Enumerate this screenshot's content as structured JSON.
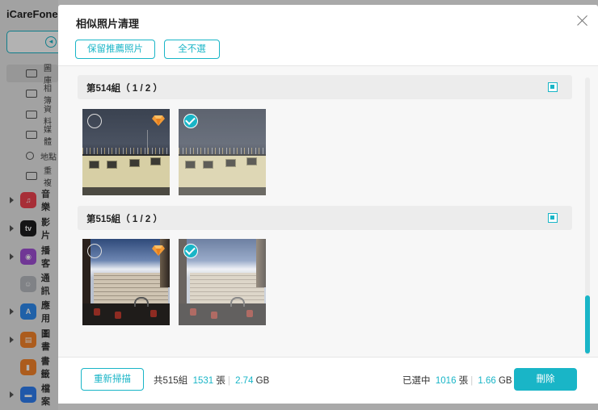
{
  "app": {
    "name": "iCareFone",
    "nav": [
      "圖庫",
      "相簿",
      "資料",
      "媒體",
      "地點",
      "重複"
    ],
    "apps": [
      {
        "label": "音樂",
        "color": "#f0424f",
        "glyph": "♫"
      },
      {
        "label": "影片",
        "color": "#1d1d1f",
        "glyph": "tv"
      },
      {
        "label": "播客",
        "color": "#a14fd6",
        "glyph": "◉"
      },
      {
        "label": "通訊",
        "color": "#b8bbc1",
        "glyph": "☺"
      },
      {
        "label": "應用",
        "color": "#2f8cf1",
        "glyph": "A"
      },
      {
        "label": "圖書",
        "color": "#f6852a",
        "glyph": "▤"
      },
      {
        "label": "書籤",
        "color": "#f6852a",
        "glyph": "▮"
      },
      {
        "label": "檔案",
        "color": "#2f7ef2",
        "glyph": "▬"
      }
    ]
  },
  "modal": {
    "title": "相似照片清理",
    "keep_recommended_label": "保留推薦照片",
    "deselect_all_label": "全不選"
  },
  "groups": [
    {
      "title": "第514組",
      "count": "（ 1 / 2 ）"
    },
    {
      "title": "第515組",
      "count": "（ 1 / 2 ）"
    }
  ],
  "footer": {
    "rescan_label": "重新掃描",
    "total_prefix": "共515組",
    "total_count": "1531",
    "count_unit": "張",
    "total_size": "2.74",
    "size_unit": "GB",
    "selected_prefix": "已選中",
    "selected_count": "1016",
    "selected_size": "1.66",
    "delete_label": "刪除"
  },
  "colors": {
    "accent": "#19b5c7"
  }
}
